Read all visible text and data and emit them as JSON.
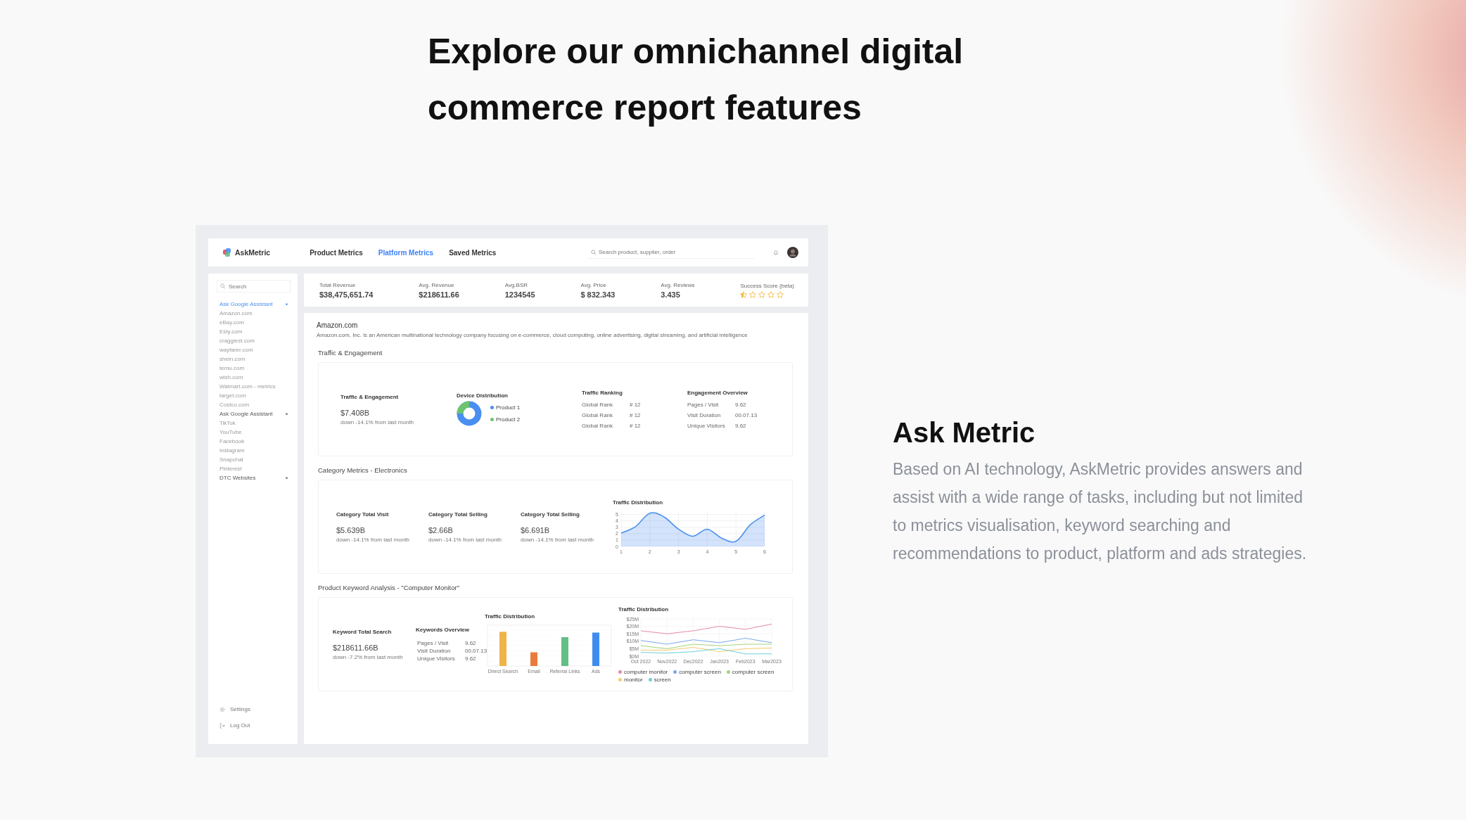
{
  "heading": "Explore our omnichannel digital commerce report features",
  "dashboard": {
    "brand": "AskMetric",
    "nav": [
      {
        "label": "Product Metrics",
        "selected": false
      },
      {
        "label": "Platform Metrics",
        "selected": true
      },
      {
        "label": "Saved Metrics",
        "selected": false
      }
    ],
    "search_placeholder": "Search product, supplier, order",
    "sidebar": {
      "search_placeholder": "Search",
      "groups": [
        {
          "label": "Ask Google Assistant",
          "selected": true,
          "children": [
            "Amazon.com",
            "eBay.com",
            "Esty.com",
            "craggiest.com",
            "wayfarer.com",
            "shein.com",
            "temu.com",
            "wish.com",
            "Walmart.com - metrics",
            "target.com",
            "Costco.com"
          ]
        },
        {
          "label": "Ask Google Assistant",
          "selected": false,
          "children": [
            "TikTok",
            "YouTube",
            "Facebook",
            "Instagram",
            "Snapchat",
            "Pinterest"
          ]
        },
        {
          "label": "DTC Websites",
          "selected": false
        }
      ],
      "footer": [
        {
          "kind": "settings",
          "label": "Settings"
        },
        {
          "kind": "logout",
          "label": "Log Out"
        }
      ]
    },
    "kpis": [
      {
        "kind": "value",
        "label": "Total Revenue",
        "value": "$38,475,651.74"
      },
      {
        "kind": "value",
        "label": "Avg. Revenue",
        "value": "$218611.66"
      },
      {
        "kind": "value",
        "label": "Avg.BSR",
        "value": "1234545"
      },
      {
        "kind": "value",
        "label": "Avg. Price",
        "value": "$ 832.343"
      },
      {
        "kind": "value",
        "label": "Avg. Reviews",
        "value": "3.435"
      },
      {
        "kind": "stars",
        "label": "Success Score (beta)",
        "stars": 0.5
      }
    ],
    "company": {
      "name": "Amazon.com",
      "description": "Amazon.com, Inc. is an American multinational technology company focusing on e-commerce, cloud computing, online advertising, digital streaming, and artificial intelligence"
    },
    "traffic": {
      "title": "Traffic & Engagement",
      "summary": {
        "title": "Traffic & Engagement",
        "value": "$7.408B",
        "change": "down -14.1% from last month"
      },
      "device": {
        "title": "Device Distribution",
        "legend": [
          {
            "label": "Product 1",
            "color": "#4a8ff0"
          },
          {
            "label": "Product 2",
            "color": "#6cc46e"
          }
        ]
      },
      "ranking": {
        "title": "Traffic Ranking",
        "rows": [
          {
            "label": "Global Rank",
            "value": "# 12"
          },
          {
            "label": "Global Rank",
            "value": "# 12"
          },
          {
            "label": "Global Rank",
            "value": "# 12"
          }
        ]
      },
      "engagement": {
        "title": "Engagement Overview",
        "rows": [
          {
            "label": "Pages / Visit",
            "value": "9.62"
          },
          {
            "label": "Visit Duration",
            "value": "00.07.13"
          },
          {
            "label": "Unique Visitors",
            "value": "9.62"
          }
        ]
      }
    },
    "category": {
      "title": "Category Metrics - Electronics",
      "stats": [
        {
          "title": "Category Total Visit",
          "value": "$5.639B",
          "change": "down -14.1% from last month"
        },
        {
          "title": "Category Total Selling",
          "value": "$2.66B",
          "change": "down -14.1% from last month"
        },
        {
          "title": "Category Total Selling",
          "value": "$6.691B",
          "change": "down -14.1% from last month"
        }
      ],
      "chart_data": {
        "type": "area",
        "title": "Traffic Distribution",
        "color": "#4a8ff0",
        "grid": true,
        "x": [
          1,
          1.5,
          2,
          2.5,
          3,
          3.5,
          4,
          4.5,
          5,
          5.5,
          6
        ],
        "values": [
          2.1,
          3.1,
          5.2,
          4.6,
          2.7,
          1.6,
          2.7,
          1.3,
          0.8,
          3.4,
          4.9
        ],
        "xlim": [
          1,
          6
        ],
        "ylim": [
          0,
          5.5
        ],
        "xticks": [
          1,
          2,
          3,
          4,
          5,
          6
        ],
        "yticks": [
          0,
          1,
          2,
          3,
          4,
          5
        ]
      }
    },
    "keyword": {
      "title": "Product Keyword Analysis - \"Computer Monitor\"",
      "summary": {
        "title": "Keyword Total Search",
        "value": "$218611.66B",
        "change": "down -7.2% from last month"
      },
      "overview": {
        "title": "Keywords Overview",
        "rows": [
          {
            "label": "Pages / Visit",
            "value": "9.62"
          },
          {
            "label": "Visit Duration",
            "value": "00.07.13"
          },
          {
            "label": "Unique Visitors",
            "value": "9.62"
          }
        ]
      },
      "bar_chart": {
        "title": "Traffic Distribution",
        "categories": [
          {
            "label": "Direct Search",
            "color": "#f0b34a"
          },
          {
            "label": "Email",
            "color": "#ea7a3c"
          },
          {
            "label": "Referral Links",
            "color": "#62bf85"
          },
          {
            "label": "Ads",
            "color": "#3f8cf0"
          }
        ]
      },
      "chart_data": {
        "type": "line",
        "title": "Traffic Distribution",
        "grid": true,
        "categories": [
          "Oct 2022",
          "Nov2022",
          "Dec2022",
          "Jan2023",
          "Feb2023",
          "Mar2023"
        ],
        "series": [
          {
            "name": "computer monitor",
            "color": "#e58aa8",
            "values": [
              17,
              15,
              17,
              20,
              18,
              21.5
            ]
          },
          {
            "name": "computer screen",
            "color": "#7aa9ee",
            "values": [
              10.5,
              8,
              11,
              9,
              12,
              9
            ]
          },
          {
            "name": "computer screen",
            "color": "#a6d27a",
            "values": [
              7,
              5,
              8,
              7,
              8,
              8
            ]
          },
          {
            "name": "monitor",
            "color": "#f3cf6e",
            "values": [
              4,
              4,
              6,
              3,
              5,
              5.5
            ]
          },
          {
            "name": "screen",
            "color": "#6ccfd8",
            "values": [
              2.5,
              2,
              3,
              5,
              1.5,
              1.5
            ]
          }
        ],
        "ylim": [
          0,
          25
        ],
        "yticks": [
          {
            "value": 0,
            "label": "$0M"
          },
          {
            "value": 5,
            "label": "$5M"
          },
          {
            "value": 10,
            "label": "$10M"
          },
          {
            "value": 15,
            "label": "$15M"
          },
          {
            "value": 20,
            "label": "$20M"
          },
          {
            "value": 25,
            "label": "$25M"
          }
        ]
      }
    }
  },
  "feature": {
    "title": "Ask Metric",
    "text": "Based on AI technology, AskMetric provides answers and assist with a wide range of tasks, including but not limited to metrics visualisation, keyword searching and recommendations to product, platform and ads strategies."
  }
}
